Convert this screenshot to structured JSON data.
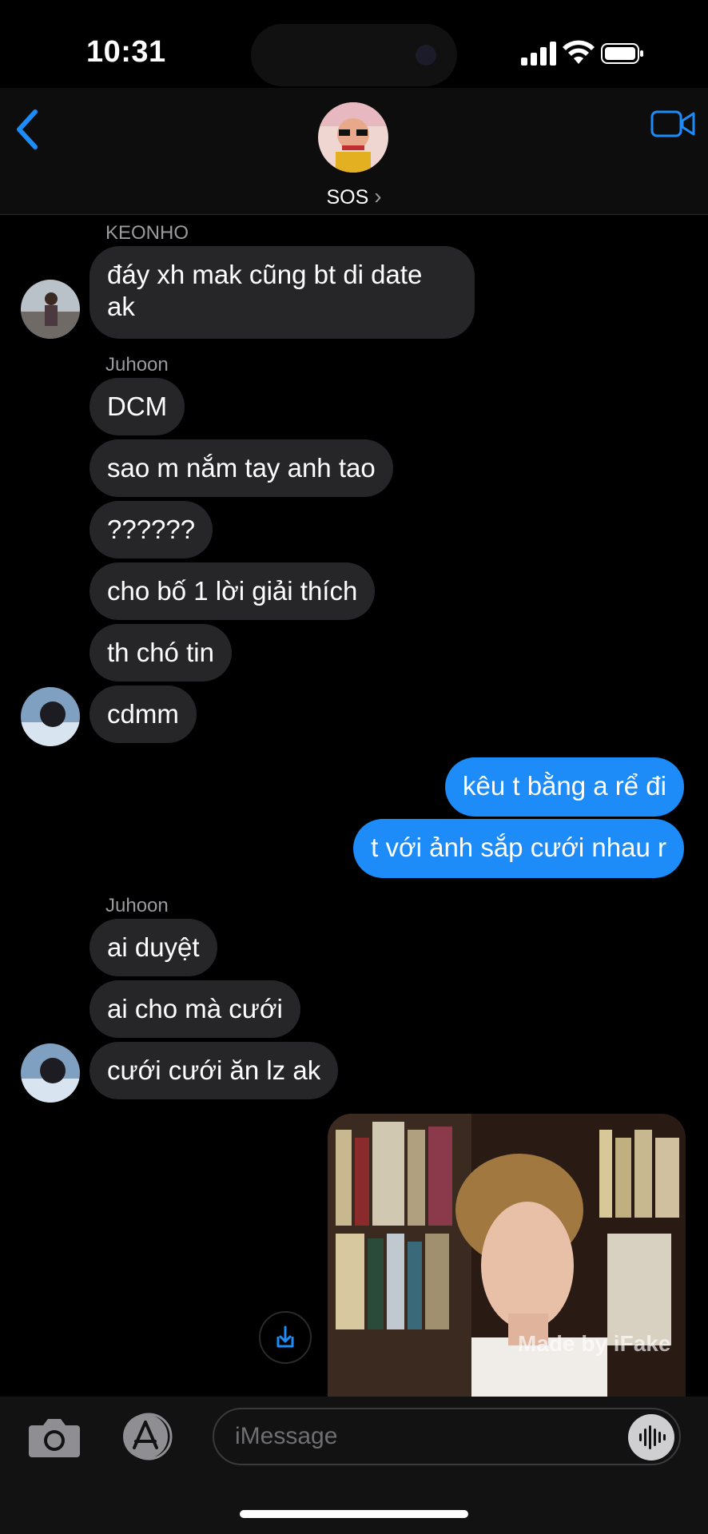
{
  "status_bar": {
    "time": "10:31"
  },
  "header": {
    "contact_name": "SOS",
    "chevron": "›"
  },
  "messages": [
    {
      "sender": "KEONHO",
      "text_lines": [
        "đáy xh mak cũng bt di date",
        "ak"
      ]
    },
    {
      "sender": "Juhoon"
    },
    {
      "text": "DCM"
    },
    {
      "text": "sao m nắm tay anh tao"
    },
    {
      "text": "??????"
    },
    {
      "text": "cho bố 1 lời giải thích"
    },
    {
      "text": "th chó tin"
    },
    {
      "text": "cdmm"
    },
    {
      "text": "kêu t bằng a rể đi"
    },
    {
      "text": "t với ảnh sắp cưới nhau r"
    },
    {
      "sender": "Juhoon"
    },
    {
      "text": "ai duyệt"
    },
    {
      "text": "ai cho mà cưới"
    },
    {
      "text": "cưới cưới ăn lz ak"
    }
  ],
  "photo": {
    "watermark": "Made by iFake"
  },
  "composer": {
    "placeholder": "iMessage"
  },
  "colors": {
    "outgoing": "#1d8bf8",
    "incoming": "#262629",
    "accent": "#1d8bf8"
  }
}
